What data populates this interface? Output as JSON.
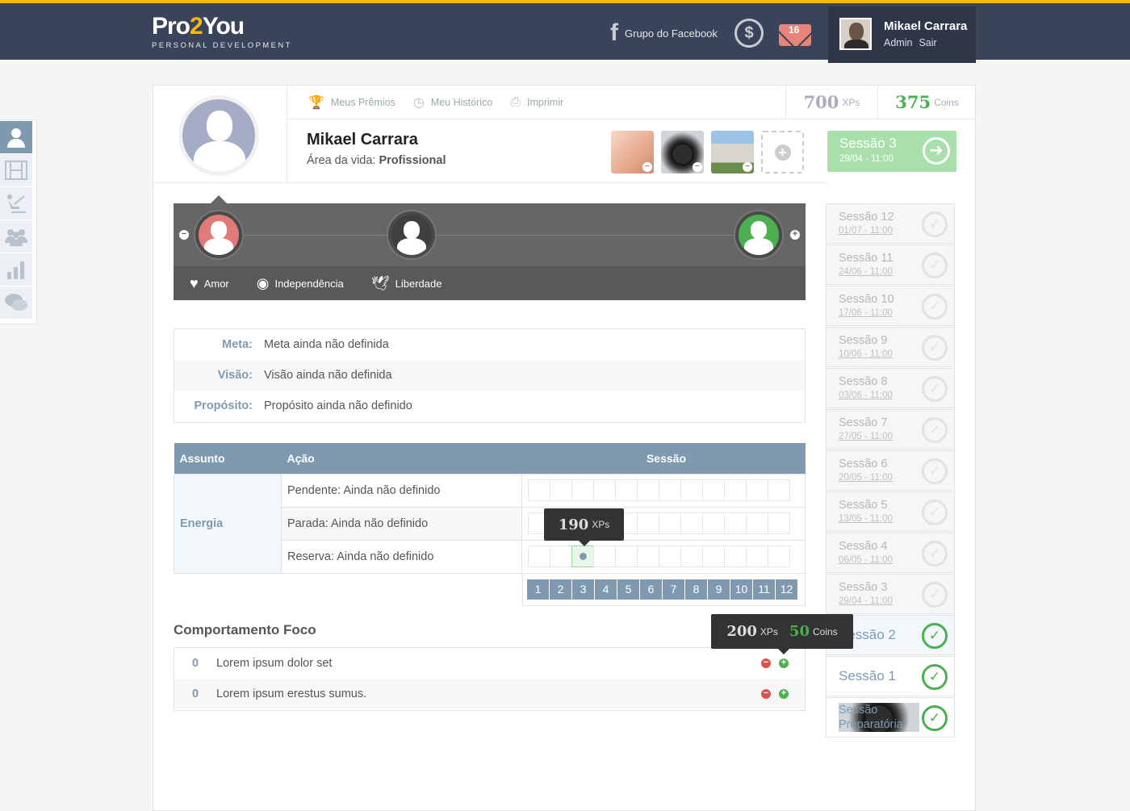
{
  "header": {
    "logo_main_a": "Pro",
    "logo_main_b": "2",
    "logo_main_c": "You",
    "logo_sub": "PERSONAL DEVELOPMENT",
    "facebook_label": "Grupo do Facebook",
    "mail_count": "16",
    "user_name": "Mikael Carrara",
    "link_admin": "Admin",
    "link_logout": "Sair"
  },
  "sidenav": {
    "items": [
      "user-icon",
      "film-icon",
      "presentation-icon",
      "group-icon",
      "chart-icon",
      "chat-icon"
    ]
  },
  "toolbar": {
    "awards": "Meus Prêmios",
    "history": "Meu Histórico",
    "print": "Imprimir"
  },
  "stats": {
    "xps_value": "700",
    "xps_label": "XPs",
    "coins_value": "375",
    "coins_label": "Coins"
  },
  "profile": {
    "name": "Mikael Carrara",
    "area_label": "Área da vida:",
    "area_value": "Profissional"
  },
  "current_session": {
    "title": "Sessão 3",
    "date": "29/04 - 11:00"
  },
  "values": {
    "items": [
      {
        "icon": "heart-icon",
        "label": "Amor"
      },
      {
        "icon": "eye-icon",
        "label": "Independência"
      },
      {
        "icon": "bird-icon",
        "label": "Liberdade"
      }
    ]
  },
  "goals": [
    {
      "key": "Meta:",
      "value": "Meta ainda não definida"
    },
    {
      "key": "Visão:",
      "value": "Visão ainda não definida"
    },
    {
      "key": "Propósito:",
      "value": "Propósito ainda não definido"
    }
  ],
  "actions_table": {
    "headers": {
      "subject": "Assunto",
      "action": "Ação",
      "session": "Sessão"
    },
    "subject": "Energia",
    "rows": [
      {
        "action": "Pendente: Ainda não definido"
      },
      {
        "action": "Parada: Ainda não definido"
      },
      {
        "action": "Reserva: Ainda não definido"
      }
    ],
    "session_numbers": [
      "1",
      "2",
      "3",
      "4",
      "5",
      "6",
      "7",
      "8",
      "9",
      "10",
      "11",
      "12"
    ]
  },
  "tooltip_action": {
    "value": "190",
    "unit": "XPs"
  },
  "tooltip_focus": {
    "xps": "200",
    "xps_unit": "XPs",
    "coins": "50",
    "coins_unit": "Coins"
  },
  "focus": {
    "title": "Comportamento Foco",
    "rows": [
      {
        "count": "0",
        "text": "Lorem ipsum dolor set"
      },
      {
        "count": "0",
        "text": "Lorem ipsum erestus sumus."
      }
    ]
  },
  "sessions": [
    {
      "title": "Sessão 12",
      "date": "01/07 - 11:00"
    },
    {
      "title": "Sessão 11",
      "date": "24/06 - 11:00"
    },
    {
      "title": "Sessão 10",
      "date": "17/06 - 11:00"
    },
    {
      "title": "Sessão 9",
      "date": "10/06 - 11:00"
    },
    {
      "title": "Sessão 8",
      "date": "03/06 - 11:00"
    },
    {
      "title": "Sessão 7",
      "date": "27/05 - 11:00"
    },
    {
      "title": "Sessão 6",
      "date": "20/05 - 11:00"
    },
    {
      "title": "Sessão 5",
      "date": "13/05 - 11:00"
    },
    {
      "title": "Sessão 4",
      "date": "06/05 - 11:00"
    },
    {
      "title": "Sessão 3",
      "date": "29/04 - 11:00"
    }
  ],
  "sessions_done": [
    "Sessão 2",
    "Sessão 1",
    "Sessão Preparatória"
  ],
  "colors": {
    "accent": "#7f9ab0",
    "brand": "#f7b614",
    "success": "#4caf50",
    "danger": "#d9534f",
    "header_bg": "#39435a"
  }
}
